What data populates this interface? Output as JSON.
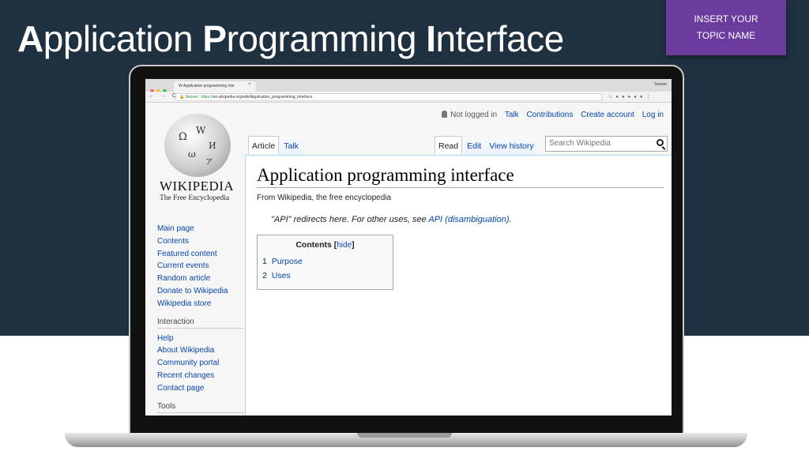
{
  "slide": {
    "title_parts": [
      {
        "bold": "A",
        "rest": "pplication "
      },
      {
        "bold": "P",
        "rest": "rogramming "
      },
      {
        "bold": "I",
        "rest": "nterface"
      }
    ],
    "topic_line1": "INSERT YOUR",
    "topic_line2": "TOPIC NAME"
  },
  "browser": {
    "tab_title": "W Application programming inte",
    "tab_close": "×",
    "user": "Smoon",
    "url_secure": "Secure",
    "url_scheme": "https://",
    "url_rest": "en.wikipedia.org/wiki/Application_programming_interface",
    "nav": "← → C"
  },
  "wiki": {
    "logo_word": "WIKIPEDIA",
    "logo_tagline": "The Free Encyclopedia",
    "personal": {
      "not_logged_in": "Not logged in",
      "talk": "Talk",
      "contributions": "Contributions",
      "create_account": "Create account",
      "login": "Log in"
    },
    "tabs_left": [
      "Article",
      "Talk"
    ],
    "tabs_right": [
      "Read",
      "Edit",
      "View history"
    ],
    "search_placeholder": "Search Wikipedia",
    "sidebar": {
      "nav": [
        "Main page",
        "Contents",
        "Featured content",
        "Current events",
        "Random article",
        "Donate to Wikipedia",
        "Wikipedia store"
      ],
      "interaction_heading": "Interaction",
      "interaction": [
        "Help",
        "About Wikipedia",
        "Community portal",
        "Recent changes",
        "Contact page"
      ],
      "tools_heading": "Tools"
    },
    "article": {
      "title": "Application programming interface",
      "from": "From Wikipedia, the free encyclopedia",
      "hatnote_text": "\"API\" redirects here. For other uses, see ",
      "hatnote_link": "API (disambiguation)",
      "hatnote_end": ".",
      "toc_title": "Contents",
      "toc_hide": "hide",
      "toc_items": [
        {
          "num": "1",
          "label": "Purpose"
        },
        {
          "num": "2",
          "label": "Uses"
        }
      ]
    }
  }
}
